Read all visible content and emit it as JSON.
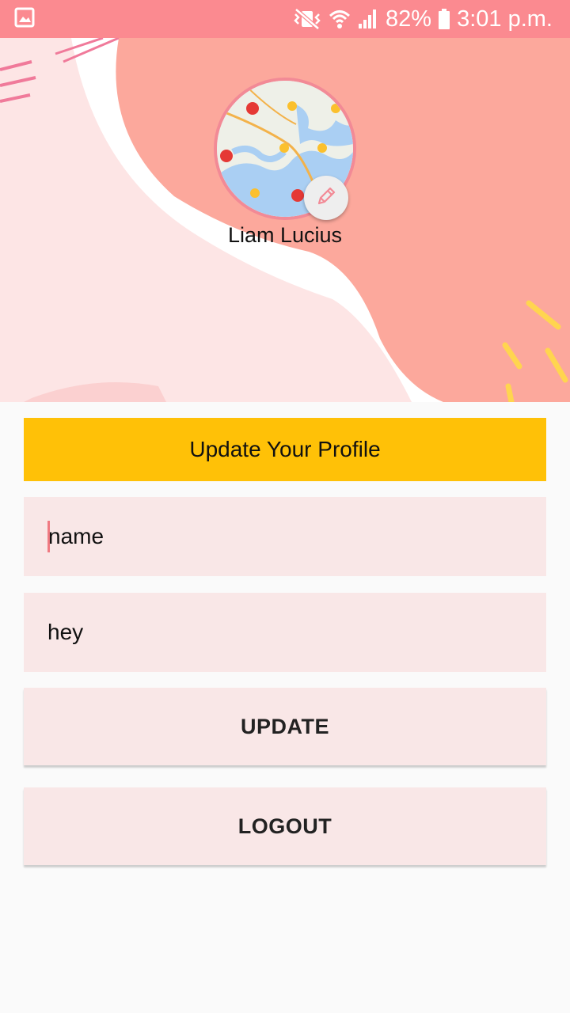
{
  "status_bar": {
    "battery": "82%",
    "time": "3:01 p.m.",
    "icons": [
      "gallery-icon",
      "vibrate-icon",
      "wifi-icon",
      "signal-icon",
      "battery-icon"
    ]
  },
  "profile": {
    "name": "Liam Lucius",
    "avatar": "map-avatar",
    "edit_icon": "pencil-icon"
  },
  "form": {
    "banner": "Update Your Profile",
    "name_value": "name",
    "status_value": "hey",
    "update_label": "UPDATE",
    "logout_label": "LOGOUT"
  },
  "colors": {
    "status_bar": "#fb8a90",
    "banner": "#ffc107",
    "field_bg": "#f9e7e7",
    "header_blob": "#fca89c",
    "accent_yellow": "#ffd54f"
  }
}
